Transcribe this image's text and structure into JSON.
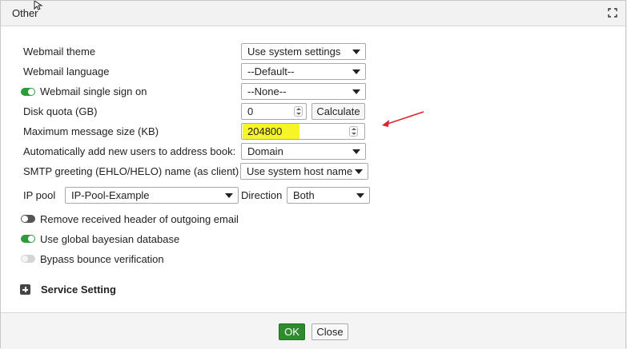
{
  "dialog": {
    "title": "Other"
  },
  "form": {
    "webmail_theme": {
      "label": "Webmail theme",
      "value": "Use system settings"
    },
    "webmail_language": {
      "label": "Webmail language",
      "value": "--Default--"
    },
    "webmail_sso": {
      "label": "Webmail single sign on",
      "value": "--None--",
      "enabled": true
    },
    "disk_quota": {
      "label": "Disk quota (GB)",
      "value": "0",
      "button": "Calculate"
    },
    "max_message_size": {
      "label": "Maximum message size (KB)",
      "value": "204800"
    },
    "auto_add_users": {
      "label": "Automatically add new users to address book:",
      "value": "Domain"
    },
    "smtp_greeting": {
      "label": "SMTP greeting (EHLO/HELO) name (as client)",
      "value": "Use system host name"
    },
    "ip_pool": {
      "label": "IP pool",
      "value": "IP-Pool-Example",
      "direction_label": "Direction",
      "direction_value": "Both"
    },
    "toggles": {
      "remove_received_header": {
        "label": "Remove received header of outgoing email",
        "enabled": false
      },
      "global_bayesian": {
        "label": "Use global bayesian database",
        "enabled": true
      },
      "bypass_bounce": {
        "label": "Bypass bounce verification",
        "enabled": false,
        "disabled": true
      }
    },
    "service_setting": {
      "label": "Service Setting"
    }
  },
  "footer": {
    "ok_label": "OK",
    "close_label": "Close"
  },
  "colors": {
    "toggle_on": "#2e9a3a",
    "ok_button": "#2e8b2e",
    "highlight": "#f5f52a",
    "annotation_arrow": "#d9262b"
  },
  "icons": [
    "maximize-icon",
    "mouse-cursor-icon",
    "expand-plus-icon",
    "chevron-down-icon",
    "spinner-icon"
  ]
}
